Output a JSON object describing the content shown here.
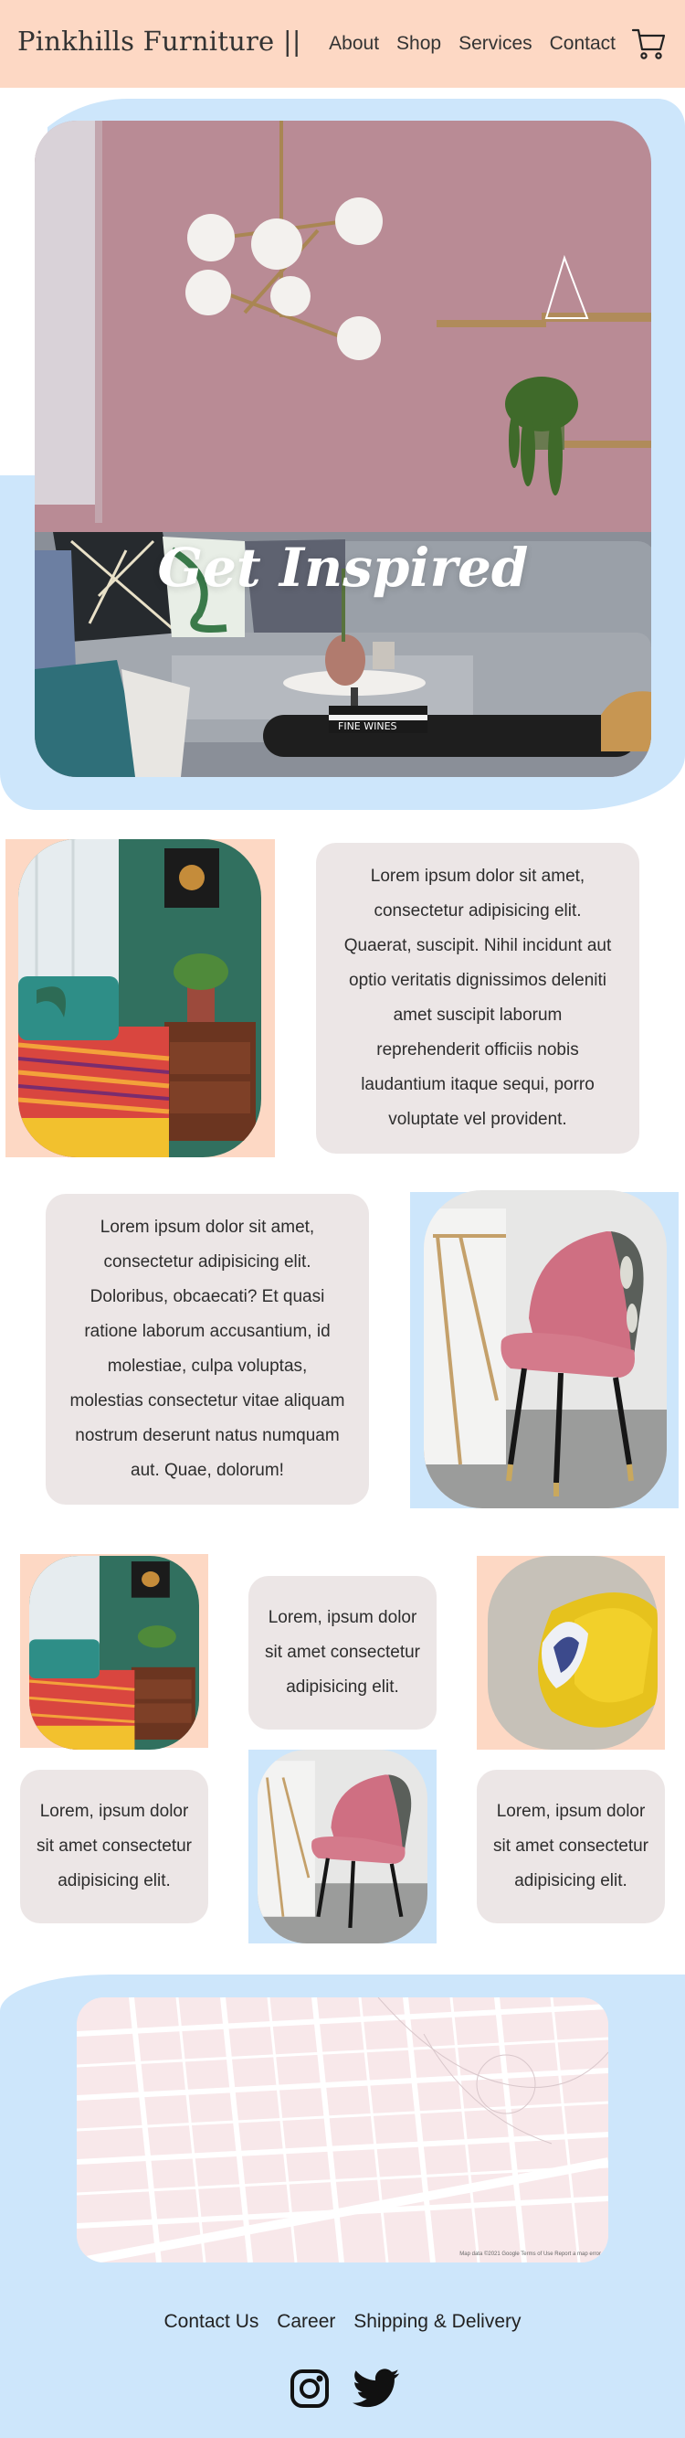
{
  "header": {
    "brand": "Pinkhills Furniture ||",
    "nav": [
      "About",
      "Shop",
      "Services",
      "Contact"
    ],
    "cart_icon": "cart-icon"
  },
  "hero": {
    "title": "Get Inspired"
  },
  "section1": {
    "text": "Lorem ipsum dolor sit amet, consectetur adipisicing elit. Quaerat, suscipit. Nihil incidunt aut optio veritatis dignissimos deleniti amet suscipit laborum reprehenderit officiis nobis laudantium itaque sequi, porro voluptate vel provident."
  },
  "section2": {
    "text": "Lorem ipsum dolor sit amet, consectetur adipisicing elit. Doloribus, obcaecati? Et quasi ratione laborum accusantium, id molestiae, culpa voluptas, molestias consectetur vitae aliquam nostrum deserunt natus numquam aut. Quae, dolorum!"
  },
  "grid": {
    "card_top": "Lorem, ipsum dolor sit amet consectetur adipisicing elit.",
    "card_bottom_left": "Lorem, ipsum dolor sit amet consectetur adipisicing elit.",
    "card_bottom_right": "Lorem, ipsum dolor sit amet consectetur adipisicing elit."
  },
  "map": {
    "attribution": "Map data ©2021 Google   Terms of Use   Report a map error"
  },
  "footer": {
    "links": [
      "Contact Us",
      "Career",
      "Shipping & Delivery"
    ],
    "social": [
      "instagram-icon",
      "twitter-icon"
    ]
  },
  "colors": {
    "header_bg": "#fdd8c4",
    "accent_blue": "#cde6fb",
    "card_bg": "#ece6e6"
  }
}
